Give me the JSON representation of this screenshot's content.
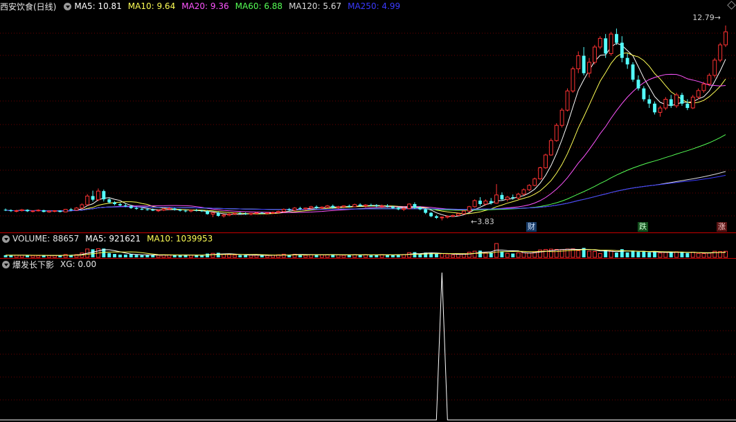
{
  "stock": {
    "name": "西安饮食(日线)"
  },
  "ma_legend": [
    {
      "label": "MA5: 10.81",
      "color": "#ffffff"
    },
    {
      "label": "MA10: 9.64",
      "color": "#ffff55"
    },
    {
      "label": "MA20: 9.36",
      "color": "#ff55ff"
    },
    {
      "label": "MA60: 6.88",
      "color": "#55ff55"
    },
    {
      "label": "MA120: 5.67",
      "color": "#dddddd"
    },
    {
      "label": "MA250: 4.99",
      "color": "#3a3aff"
    }
  ],
  "volume_legend": [
    {
      "label": "VOLUME: 88657",
      "color": "#e6e6e6"
    },
    {
      "label": "MA5: 921621",
      "color": "#ffffff"
    },
    {
      "label": "MA10: 1039953",
      "color": "#ffff55"
    }
  ],
  "indicator_legend": [
    {
      "label": "爆发长下影",
      "color": "#e6e6e6"
    },
    {
      "label": "XG: 0.00",
      "color": "#e6e6e6"
    }
  ],
  "price_marks": {
    "high": "12.79",
    "low": "3.83"
  },
  "badges": {
    "cai": "财",
    "die": "跌",
    "zhang": "涨"
  },
  "colors": {
    "up": "#ff3232",
    "down": "#54fcfc",
    "grid": "#6e0000",
    "separator": "#c80000"
  },
  "chart_data": {
    "type": "candlestick",
    "price_range": [
      3.5,
      13.2
    ],
    "candles": [
      [
        4.32,
        4.38,
        4.26,
        4.3
      ],
      [
        4.3,
        4.34,
        4.22,
        4.26
      ],
      [
        4.26,
        4.32,
        4.2,
        4.28
      ],
      [
        4.28,
        4.36,
        4.24,
        4.32
      ],
      [
        4.32,
        4.34,
        4.22,
        4.25
      ],
      [
        4.25,
        4.3,
        4.2,
        4.27
      ],
      [
        4.27,
        4.34,
        4.24,
        4.3
      ],
      [
        4.3,
        4.32,
        4.2,
        4.22
      ],
      [
        4.22,
        4.28,
        4.18,
        4.26
      ],
      [
        4.26,
        4.3,
        4.2,
        4.28
      ],
      [
        4.28,
        4.3,
        4.2,
        4.22
      ],
      [
        4.22,
        4.36,
        4.2,
        4.34
      ],
      [
        4.34,
        4.4,
        4.26,
        4.3
      ],
      [
        4.3,
        4.44,
        4.28,
        4.4
      ],
      [
        4.4,
        4.62,
        4.36,
        4.55
      ],
      [
        4.55,
        5.04,
        4.5,
        4.95
      ],
      [
        4.95,
        5.2,
        4.7,
        4.78
      ],
      [
        4.78,
        5.3,
        4.72,
        5.18
      ],
      [
        5.18,
        5.25,
        4.7,
        4.8
      ],
      [
        4.8,
        4.86,
        4.6,
        4.66
      ],
      [
        4.66,
        4.72,
        4.52,
        4.58
      ],
      [
        4.58,
        4.64,
        4.48,
        4.52
      ],
      [
        4.52,
        4.6,
        4.44,
        4.48
      ],
      [
        4.48,
        4.54,
        4.36,
        4.4
      ],
      [
        4.4,
        4.46,
        4.32,
        4.36
      ],
      [
        4.36,
        4.42,
        4.3,
        4.34
      ],
      [
        4.34,
        4.4,
        4.28,
        4.32
      ],
      [
        4.32,
        4.38,
        4.26,
        4.28
      ],
      [
        4.28,
        4.34,
        4.22,
        4.3
      ],
      [
        4.3,
        4.4,
        4.26,
        4.36
      ],
      [
        4.36,
        4.44,
        4.3,
        4.38
      ],
      [
        4.38,
        4.42,
        4.28,
        4.32
      ],
      [
        4.32,
        4.36,
        4.24,
        4.28
      ],
      [
        4.28,
        4.34,
        4.2,
        4.26
      ],
      [
        4.26,
        4.32,
        4.2,
        4.3
      ],
      [
        4.3,
        4.36,
        4.24,
        4.28
      ],
      [
        4.28,
        4.32,
        4.22,
        4.26
      ],
      [
        4.26,
        4.3,
        4.1,
        4.12
      ],
      [
        4.12,
        4.2,
        3.98,
        4.18
      ],
      [
        4.18,
        4.24,
        4.0,
        4.04
      ],
      [
        4.04,
        4.12,
        3.96,
        4.08
      ],
      [
        4.08,
        4.16,
        4.02,
        4.12
      ],
      [
        4.12,
        4.2,
        4.08,
        4.16
      ],
      [
        4.16,
        4.22,
        4.1,
        4.14
      ],
      [
        4.14,
        4.2,
        4.08,
        4.12
      ],
      [
        4.12,
        4.18,
        4.06,
        4.16
      ],
      [
        4.16,
        4.22,
        4.1,
        4.18
      ],
      [
        4.18,
        4.22,
        4.12,
        4.15
      ],
      [
        4.15,
        4.2,
        4.1,
        4.18
      ],
      [
        4.18,
        4.24,
        4.12,
        4.2
      ],
      [
        4.2,
        4.28,
        4.14,
        4.24
      ],
      [
        4.24,
        4.38,
        4.2,
        4.34
      ],
      [
        4.34,
        4.4,
        4.26,
        4.3
      ],
      [
        4.3,
        4.44,
        4.26,
        4.4
      ],
      [
        4.4,
        4.46,
        4.3,
        4.36
      ],
      [
        4.36,
        4.42,
        4.3,
        4.4
      ],
      [
        4.4,
        4.5,
        4.34,
        4.46
      ],
      [
        4.46,
        4.52,
        4.36,
        4.4
      ],
      [
        4.4,
        4.48,
        4.34,
        4.44
      ],
      [
        4.44,
        4.54,
        4.4,
        4.5
      ],
      [
        4.5,
        4.56,
        4.38,
        4.42
      ],
      [
        4.42,
        4.5,
        4.36,
        4.46
      ],
      [
        4.46,
        4.52,
        4.4,
        4.5
      ],
      [
        4.5,
        4.56,
        4.42,
        4.46
      ],
      [
        4.46,
        4.6,
        4.44,
        4.56
      ],
      [
        4.56,
        4.62,
        4.46,
        4.5
      ],
      [
        4.5,
        4.58,
        4.42,
        4.54
      ],
      [
        4.54,
        4.6,
        4.48,
        4.52
      ],
      [
        4.52,
        4.58,
        4.44,
        4.48
      ],
      [
        4.48,
        4.56,
        4.4,
        4.5
      ],
      [
        4.5,
        4.58,
        4.42,
        4.46
      ],
      [
        4.46,
        4.5,
        4.36,
        4.4
      ],
      [
        4.4,
        4.46,
        4.3,
        4.34
      ],
      [
        4.34,
        4.42,
        4.26,
        4.38
      ],
      [
        4.38,
        4.62,
        4.34,
        4.58
      ],
      [
        4.58,
        4.66,
        4.36,
        4.42
      ],
      [
        4.42,
        4.48,
        4.3,
        4.34
      ],
      [
        4.34,
        4.38,
        4.12,
        4.18
      ],
      [
        4.18,
        4.22,
        3.98,
        4.02
      ],
      [
        4.02,
        4.08,
        3.9,
        3.95
      ],
      [
        3.95,
        4.02,
        3.83,
        3.98
      ],
      [
        3.98,
        4.06,
        3.92,
        4.02
      ],
      [
        4.02,
        4.1,
        3.98,
        4.06
      ],
      [
        4.06,
        4.18,
        4.02,
        4.14
      ],
      [
        4.14,
        4.3,
        4.1,
        4.26
      ],
      [
        4.26,
        4.5,
        4.2,
        4.46
      ],
      [
        4.46,
        4.8,
        4.42,
        4.74
      ],
      [
        4.74,
        4.9,
        4.5,
        4.58
      ],
      [
        4.58,
        4.8,
        4.52,
        4.72
      ],
      [
        4.72,
        4.86,
        4.56,
        4.62
      ],
      [
        4.62,
        5.5,
        4.6,
        5.0
      ],
      [
        5.0,
        5.12,
        4.74,
        4.8
      ],
      [
        4.8,
        4.96,
        4.7,
        4.9
      ],
      [
        4.9,
        5.02,
        4.78,
        4.86
      ],
      [
        4.86,
        5.1,
        4.8,
        5.04
      ],
      [
        5.04,
        5.3,
        4.98,
        5.24
      ],
      [
        5.24,
        5.5,
        5.18,
        5.44
      ],
      [
        5.44,
        5.8,
        5.4,
        5.74
      ],
      [
        5.74,
        6.3,
        5.7,
        6.25
      ],
      [
        6.25,
        6.9,
        6.2,
        6.84
      ],
      [
        6.84,
        7.6,
        6.8,
        7.5
      ],
      [
        7.5,
        8.3,
        7.45,
        8.2
      ],
      [
        8.2,
        9.0,
        8.1,
        8.9
      ],
      [
        8.9,
        9.9,
        8.84,
        9.78
      ],
      [
        9.78,
        10.9,
        9.7,
        10.8
      ],
      [
        10.8,
        11.6,
        10.6,
        11.4
      ],
      [
        11.4,
        11.8,
        10.5,
        10.6
      ],
      [
        10.6,
        11.3,
        10.4,
        11.1
      ],
      [
        11.1,
        11.9,
        11.0,
        11.8
      ],
      [
        11.8,
        12.3,
        11.7,
        12.2
      ],
      [
        12.2,
        12.4,
        11.3,
        11.5
      ],
      [
        11.5,
        12.5,
        11.4,
        12.4
      ],
      [
        12.4,
        12.65,
        11.9,
        12.0
      ],
      [
        12.0,
        12.3,
        11.1,
        11.3
      ],
      [
        11.3,
        11.5,
        10.8,
        11.0
      ],
      [
        11.0,
        11.1,
        10.2,
        10.3
      ],
      [
        10.3,
        10.5,
        9.8,
        9.9
      ],
      [
        9.9,
        10.0,
        9.3,
        9.4
      ],
      [
        9.4,
        9.6,
        9.0,
        9.2
      ],
      [
        9.2,
        9.3,
        8.7,
        8.8
      ],
      [
        8.8,
        9.1,
        8.6,
        9.0
      ],
      [
        9.0,
        9.5,
        8.9,
        9.4
      ],
      [
        9.4,
        9.6,
        9.0,
        9.1
      ],
      [
        9.1,
        9.7,
        9.0,
        9.6
      ],
      [
        9.6,
        9.7,
        9.1,
        9.2
      ],
      [
        9.2,
        9.4,
        8.9,
        9.0
      ],
      [
        9.0,
        9.6,
        8.95,
        9.5
      ],
      [
        9.5,
        9.9,
        9.4,
        9.8
      ],
      [
        9.8,
        10.2,
        9.7,
        10.1
      ],
      [
        10.1,
        10.6,
        10.0,
        10.5
      ],
      [
        10.5,
        11.3,
        10.4,
        11.2
      ],
      [
        11.2,
        12.0,
        11.1,
        11.9
      ],
      [
        11.9,
        12.79,
        11.8,
        12.5
      ]
    ],
    "ma_series_values": {
      "MA5": [
        10.81
      ],
      "MA10": [
        9.64
      ],
      "MA20": [
        9.36
      ],
      "MA60": [
        6.88
      ],
      "MA120": [
        5.67
      ],
      "MA250": [
        4.99
      ]
    },
    "volume": {
      "last": 88657,
      "ma5": 921621,
      "ma10": 1039953
    },
    "indicator": {
      "name": "爆发长下影",
      "xg": 0.0,
      "signal_at_candle": 80
    }
  }
}
